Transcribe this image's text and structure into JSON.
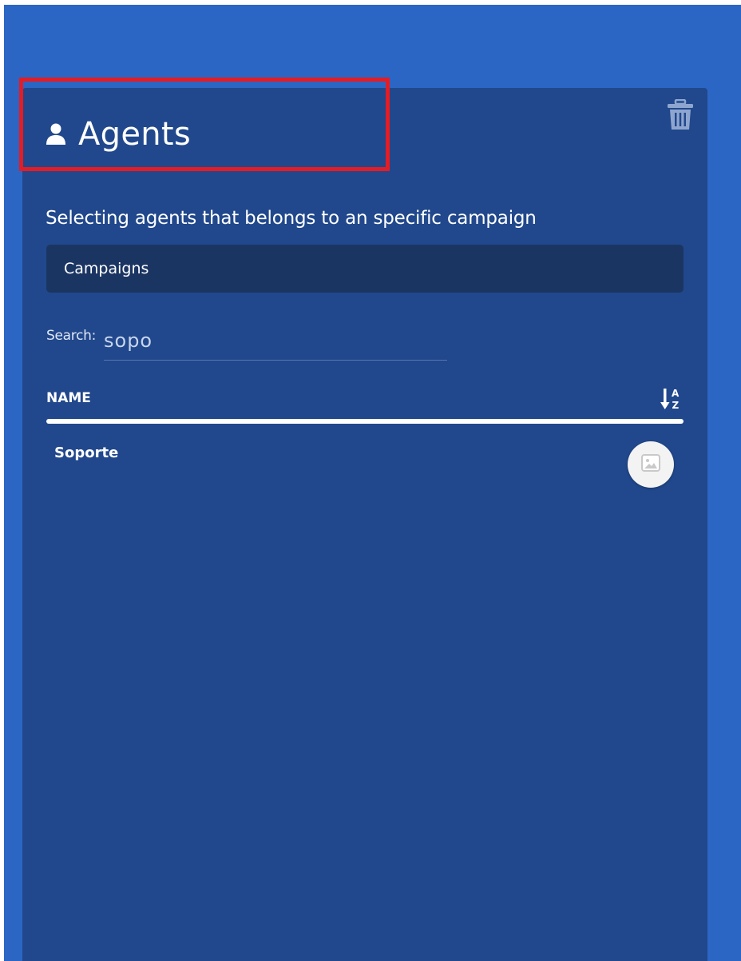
{
  "colors": {
    "background": "#2b66c4",
    "panel": "#21488c",
    "select_bg": "#1b3563",
    "highlight": "#e51c23"
  },
  "header": {
    "icon": "person-icon",
    "title": "Agents",
    "delete_icon": "trash-icon"
  },
  "description": "Selecting agents that belongs to an specific campaign",
  "campaign_select": {
    "value": "Campaigns"
  },
  "search": {
    "label": "Search:",
    "value": "sopo"
  },
  "table": {
    "columns": [
      {
        "label": "NAME",
        "sort_icon": "sort-alpha-down-icon"
      }
    ],
    "rows": [
      {
        "name": "Soporte",
        "avatar_icon": "image-placeholder-icon"
      }
    ]
  }
}
